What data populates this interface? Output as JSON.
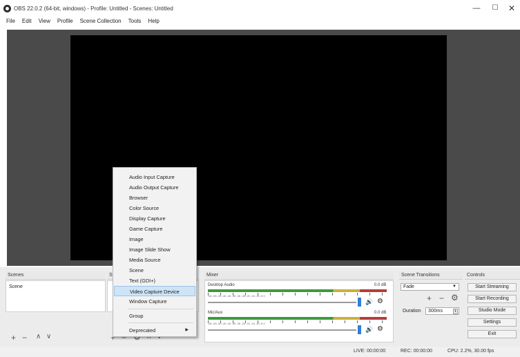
{
  "window": {
    "title": "OBS 22.0.2 (64-bit, windows) - Profile: Untitled - Scenes: Untitled",
    "minimize_glyph": "—",
    "maximize_glyph": "☐",
    "close_glyph": "✕"
  },
  "menu": [
    "File",
    "Edit",
    "View",
    "Profile",
    "Scene Collection",
    "Tools",
    "Help"
  ],
  "scenes": {
    "header": "Scenes",
    "items": [
      "Scene"
    ]
  },
  "sources": {
    "header": "So"
  },
  "mixer": {
    "header": "Mixer",
    "tracks": [
      {
        "name": "Desktop Audio",
        "db": "0.0 dB"
      },
      {
        "name": "Mic/Aux",
        "db": "0.0 dB"
      }
    ],
    "scale": "-60 -55 -50 -45 -40 -35 -30 -25 -20 -15 -10 -5 0"
  },
  "transitions": {
    "header": "Scene Transitions",
    "selected": "Fade",
    "duration_label": "Duration",
    "duration_value": "300ms"
  },
  "controls": {
    "header": "Controls",
    "buttons": [
      "Start Streaming",
      "Start Recording",
      "Studio Mode",
      "Settings",
      "Exit"
    ]
  },
  "status": {
    "live": "LIVE: 00:00:00",
    "rec": "REC: 00:00:00",
    "cpu": "CPU: 2.2%, 30.00 fps"
  },
  "context_menu": {
    "items": [
      "Audio Input Capture",
      "Audio Output Capture",
      "Browser",
      "Color Source",
      "Display Capture",
      "Game Capture",
      "Image",
      "Image Slide Show",
      "Media Source",
      "Scene",
      "Text (GDI+)",
      "Video Capture Device",
      "Window Capture",
      "Group",
      "Deprecated"
    ],
    "highlighted": "Video Capture Device"
  },
  "colors": {
    "highlight": "#cde4f7",
    "volume_thumb": "#2f7fd6",
    "preview_bg": "#4a4a4a"
  }
}
